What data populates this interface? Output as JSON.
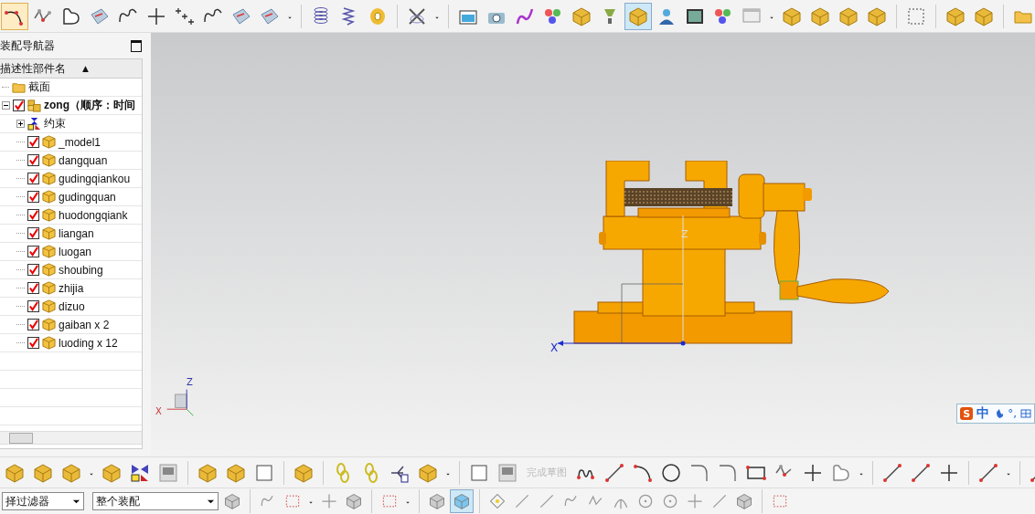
{
  "navigator": {
    "title": "装配导航器",
    "column": "描述性部件名",
    "sort_arrow": "▲",
    "tree": [
      {
        "label": "截面",
        "kind": "folder"
      },
      {
        "label": "zong（顺序：时间",
        "kind": "assembly",
        "checked": true,
        "expanded": true,
        "children": [
          {
            "label": "约束",
            "kind": "constraint",
            "expanded": false
          },
          {
            "label": "_model1",
            "kind": "part",
            "checked": true
          },
          {
            "label": "dangquan",
            "kind": "part",
            "checked": true
          },
          {
            "label": "gudingqiankou",
            "kind": "part",
            "checked": true
          },
          {
            "label": "gudingquan",
            "kind": "part",
            "checked": true
          },
          {
            "label": "huodongqiank",
            "kind": "part",
            "checked": true
          },
          {
            "label": "liangan",
            "kind": "part",
            "checked": true
          },
          {
            "label": "luogan",
            "kind": "part",
            "checked": true
          },
          {
            "label": "shoubing",
            "kind": "part",
            "checked": true
          },
          {
            "label": "zhijia",
            "kind": "part",
            "checked": true
          },
          {
            "label": "dizuo",
            "kind": "part",
            "checked": true
          },
          {
            "label": "gaiban x 2",
            "kind": "part",
            "checked": true
          },
          {
            "label": "luoding x 12",
            "kind": "part",
            "checked": true
          }
        ]
      }
    ]
  },
  "viewport": {
    "axis_x": "X",
    "axis_z": "Z",
    "triad_z": "Z",
    "triad_x": "X"
  },
  "ime": {
    "logo": "S",
    "label": "中",
    "punct": "°,"
  },
  "sketch": {
    "finish": "完成草图"
  },
  "filters": [
    {
      "value": "择过滤器"
    },
    {
      "value": "整个装配"
    }
  ]
}
